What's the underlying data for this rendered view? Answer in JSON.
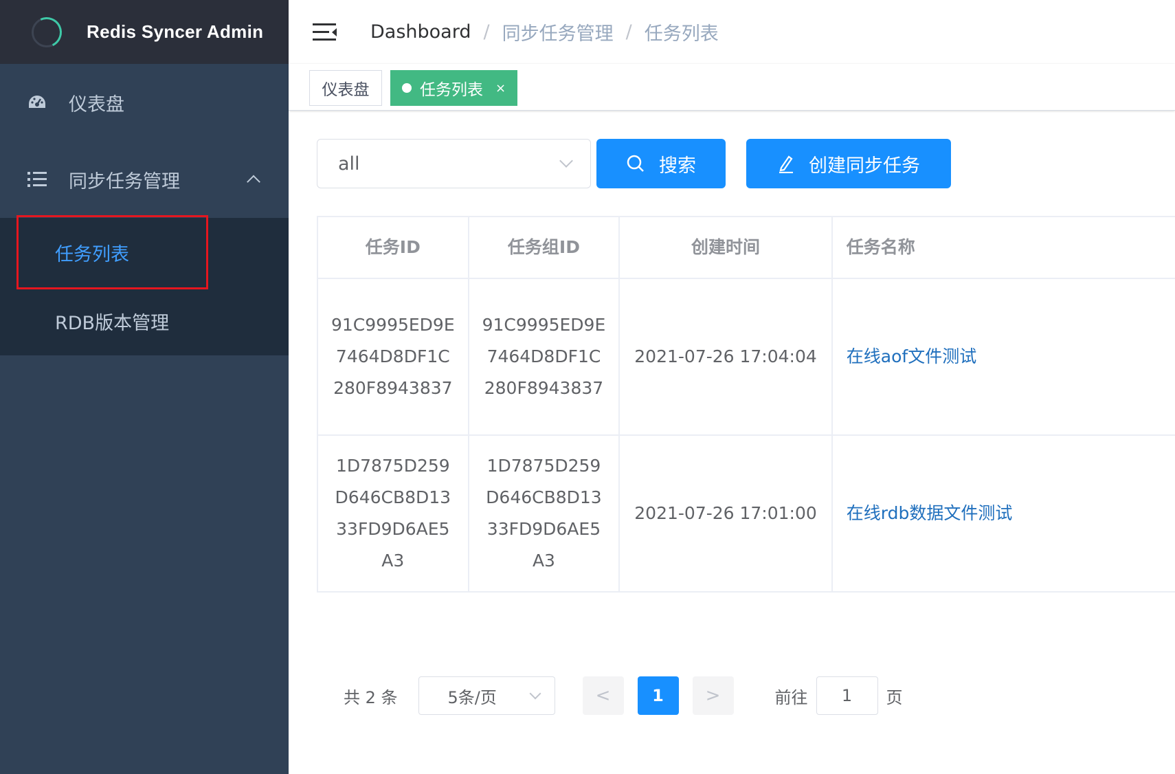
{
  "brand": {
    "title": "Redis Syncer Admin"
  },
  "sidebar": {
    "items": [
      {
        "label": "仪表盘",
        "icon": "dashboard-icon"
      },
      {
        "label": "同步任务管理",
        "icon": "list-icon",
        "expanded": true,
        "children": [
          {
            "label": "任务列表",
            "active": true
          },
          {
            "label": "RDB版本管理",
            "active": false
          }
        ]
      }
    ]
  },
  "navbar": {
    "breadcrumb": [
      "Dashboard",
      "同步任务管理",
      "任务列表"
    ],
    "separator": "/"
  },
  "tags": [
    {
      "label": "仪表盘",
      "active": false
    },
    {
      "label": "任务列表",
      "active": true,
      "close": "×"
    }
  ],
  "filter": {
    "select_value": "all",
    "search_label": "搜索",
    "create_label": "创建同步任务"
  },
  "table": {
    "columns": [
      "任务ID",
      "任务组ID",
      "创建时间",
      "任务名称"
    ],
    "rows": [
      {
        "task_id": "91C9995ED9E7464D8DF1C280F8943837",
        "group_id": "91C9995ED9E7464D8DF1C280F8943837",
        "created": "2021-07-26 17:04:04",
        "name": "在线aof文件测试"
      },
      {
        "task_id": "1D7875D259D646CB8D1333FD9D6AE5A3",
        "group_id": "1D7875D259D646CB8D1333FD9D6AE5A3",
        "created": "2021-07-26 17:01:00",
        "name": "在线rdb数据文件测试"
      }
    ]
  },
  "pagination": {
    "total": "共 2 条",
    "page_size": "5条/页",
    "prev": "<",
    "current": "1",
    "next": ">",
    "goto_label": "前往",
    "goto_value": "1",
    "page_suffix": "页"
  },
  "colors": {
    "sidebar_bg": "#304156",
    "active_link": "#409eff",
    "primary": "#1890ff",
    "tag_active": "#42b983",
    "highlight": "#e5161f"
  }
}
